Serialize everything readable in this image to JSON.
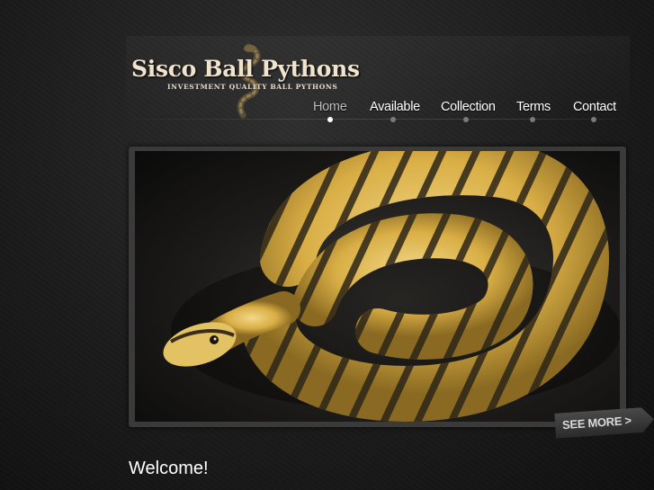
{
  "logo": {
    "title": "Sisco Ball Pythons",
    "tagline": "INVESTMENT QUALITY   BALL PYTHONS"
  },
  "nav": {
    "items": [
      {
        "label": "Home",
        "active": true
      },
      {
        "label": "Available",
        "active": false
      },
      {
        "label": "Collection",
        "active": false
      },
      {
        "label": "Terms",
        "active": false
      },
      {
        "label": "Contact",
        "active": false
      }
    ]
  },
  "slideshow": {
    "see_more_label": "SEE MORE >"
  },
  "content": {
    "heading": "Welcome!"
  },
  "colors": {
    "background": "#1c1c1c",
    "frame": "#3a3a3a",
    "snake_base": "#e0b94e",
    "snake_band": "#2b2418",
    "nav_text": "#ffffff",
    "nav_active": "#bdbdbd"
  }
}
